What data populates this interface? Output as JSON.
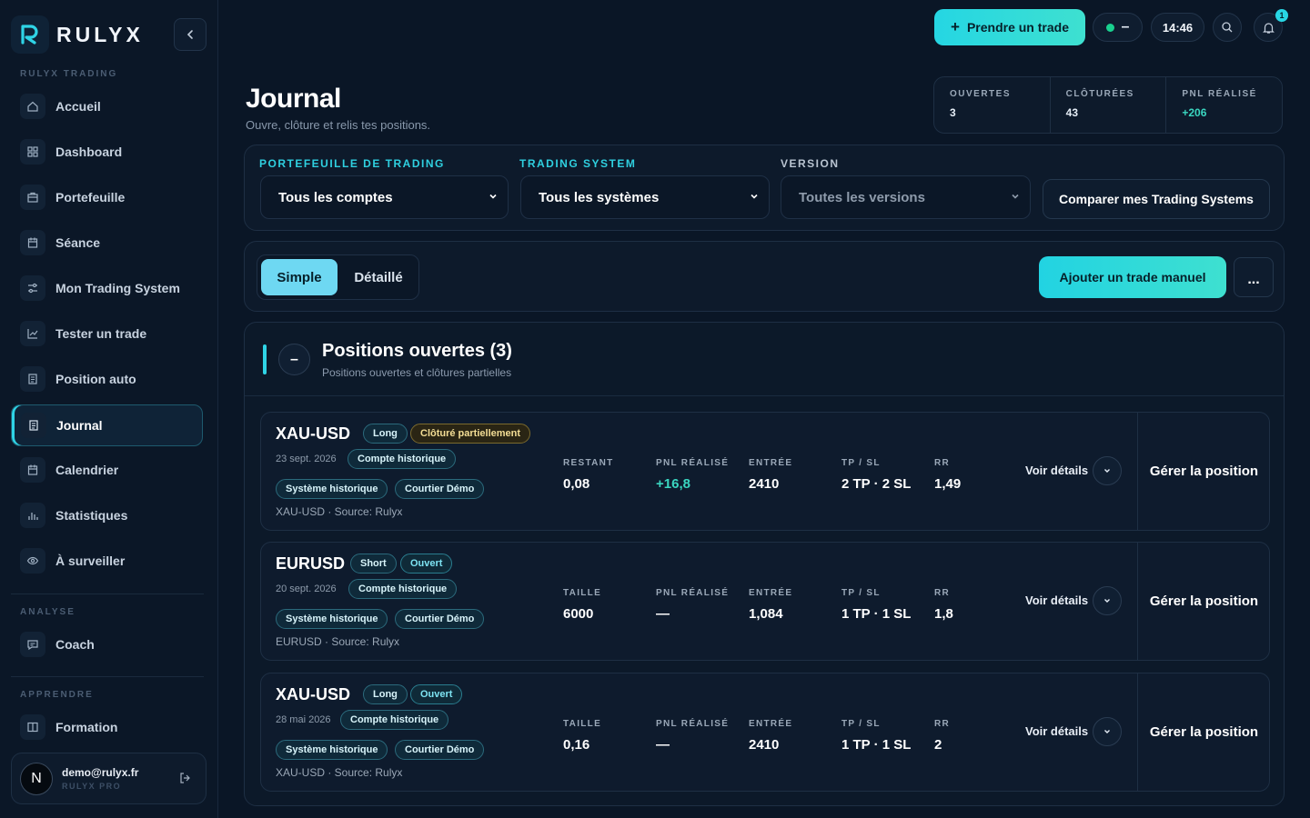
{
  "brand": {
    "name": "RULYX"
  },
  "sidebar": {
    "section_trading": "RULYX TRADING",
    "items": [
      {
        "label": "Accueil",
        "icon": "home-icon"
      },
      {
        "label": "Dashboard",
        "icon": "grid-icon"
      },
      {
        "label": "Portefeuille",
        "icon": "briefcase-icon"
      },
      {
        "label": "Séance",
        "icon": "calendar-icon"
      },
      {
        "label": "Mon Trading System",
        "icon": "sliders-icon"
      },
      {
        "label": "Tester un trade",
        "icon": "chart-check-icon"
      },
      {
        "label": "Position auto",
        "icon": "doc-icon"
      },
      {
        "label": "Journal",
        "icon": "journal-icon",
        "active": true
      },
      {
        "label": "Calendrier",
        "icon": "calendar-icon"
      },
      {
        "label": "Statistiques",
        "icon": "bar-chart-icon"
      },
      {
        "label": "À surveiller",
        "icon": "eye-icon"
      }
    ],
    "section_analyse": "ANALYSE",
    "analyse_items": [
      {
        "label": "Coach",
        "icon": "chat-icon"
      }
    ],
    "section_apprendre": "APPRENDRE",
    "apprendre_items": [
      {
        "label": "Formation",
        "icon": "book-icon"
      }
    ],
    "user": {
      "initial": "N",
      "email": "demo@rulyx.fr",
      "plan": "RULYX PRO"
    }
  },
  "topbar": {
    "cta": "Prendre un trade",
    "status_text": "–",
    "clock": "14:46",
    "notif_count": "1"
  },
  "header": {
    "title": "Journal",
    "subtitle": "Ouvre, clôture et relis tes positions.",
    "stats": [
      {
        "label": "OUVERTES",
        "value": "3"
      },
      {
        "label": "CLÔTURÉES",
        "value": "43"
      },
      {
        "label": "PNL RÉALISÉ",
        "value": "+206"
      }
    ]
  },
  "filters": {
    "portfolio_label": "PORTEFEUILLE DE TRADING",
    "portfolio_value": "Tous les comptes",
    "system_label": "TRADING SYSTEM",
    "system_value": "Tous les systèmes",
    "version_label": "VERSION",
    "version_value": "Toutes les versions",
    "compare": "Comparer mes Trading Systems"
  },
  "toolbar": {
    "simple": "Simple",
    "detailed": "Détaillé",
    "add_manual": "Ajouter un trade manuel",
    "more": "..."
  },
  "positions": {
    "toggle": "–",
    "title": "Positions ouvertes (3)",
    "subtitle": "Positions ouvertes et clôtures partielles",
    "details_label": "Voir détails",
    "manage_label": "Gérer la position",
    "trades": [
      {
        "symbol": "XAU-USD",
        "side": "Long",
        "status": "Clôturé partiellement",
        "status_kind": "warn",
        "date": "23 sept. 2026",
        "account": "Compte historique",
        "system": "Système historique",
        "broker": "Courtier Démo",
        "source": "XAU-USD · Source: Rulyx",
        "size_label": "RESTANT",
        "size": "0,08",
        "pnl_label": "PNL RÉALISÉ",
        "pnl": "+16,8",
        "entry_label": "ENTRÉE",
        "entry": "2410",
        "tpsl_label": "TP / SL",
        "tpsl": "2 TP · 2 SL",
        "rr_label": "RR",
        "rr": "1,49"
      },
      {
        "symbol": "EURUSD",
        "side": "Short",
        "status": "Ouvert",
        "status_kind": "ok",
        "date": "20 sept. 2026",
        "account": "Compte historique",
        "system": "Système historique",
        "broker": "Courtier Démo",
        "source": "EURUSD · Source: Rulyx",
        "size_label": "TAILLE",
        "size": "6000",
        "pnl_label": "PNL RÉALISÉ",
        "pnl": "—",
        "entry_label": "ENTRÉE",
        "entry": "1,084",
        "tpsl_label": "TP / SL",
        "tpsl": "1 TP · 1 SL",
        "rr_label": "RR",
        "rr": "1,8"
      },
      {
        "symbol": "XAU-USD",
        "side": "Long",
        "status": "Ouvert",
        "status_kind": "ok",
        "date": "28 mai 2026",
        "account": "Compte historique",
        "system": "Système historique",
        "broker": "Courtier Démo",
        "source": "XAU-USD · Source: Rulyx",
        "size_label": "TAILLE",
        "size": "0,16",
        "pnl_label": "PNL RÉALISÉ",
        "pnl": "—",
        "entry_label": "ENTRÉE",
        "entry": "2410",
        "tpsl_label": "TP / SL",
        "tpsl": "1 TP · 1 SL",
        "rr_label": "RR",
        "rr": "2"
      }
    ]
  }
}
